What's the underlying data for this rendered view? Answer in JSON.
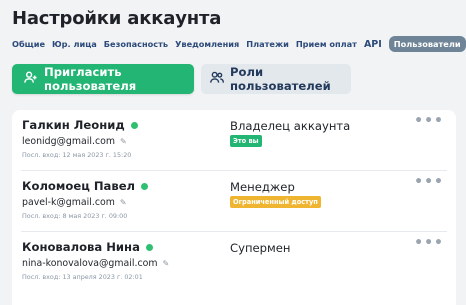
{
  "page": {
    "title": "Настройки аккаунта"
  },
  "tabs": [
    {
      "label": "Общие"
    },
    {
      "label": "Юр. лица"
    },
    {
      "label": "Безопасность"
    },
    {
      "label": "Уведомления"
    },
    {
      "label": "Платежи"
    },
    {
      "label": "Прием оплат"
    },
    {
      "label": "API"
    },
    {
      "label": "Пользователи"
    }
  ],
  "actions": {
    "invite_label": "Пригласить пользователя",
    "invite_icon": "add-user-icon",
    "roles_label": "Роли пользователей",
    "roles_icon": "users-icon"
  },
  "colors": {
    "accent": "#22b573",
    "badge_owner": "#22b573",
    "badge_limited": "#f0b530",
    "active_tab": "#6f8597",
    "online": "#2fbf71"
  },
  "users": [
    {
      "name": "Галкин Леонид",
      "online": true,
      "email": "leonidg@gmail.com",
      "last_login": "Посл. вход: 12 мая 2023 г. 15:20",
      "role": "Владелец аккаунта",
      "badge": "Это вы"
    },
    {
      "name": "Коломоец Павел",
      "online": true,
      "email": "pavel-k@gmail.com",
      "last_login": "Посл. вход: 8 мая 2023 г. 09:00",
      "role": "Менеджер",
      "badge": "Ограниченный доступ"
    },
    {
      "name": "Коновалова Нина",
      "online": true,
      "email": "nina-konovalova@gmail.com",
      "last_login": "Посл. вход: 13 апреля 2023 г. 02:01",
      "role": "Супермен",
      "badge": ""
    }
  ]
}
